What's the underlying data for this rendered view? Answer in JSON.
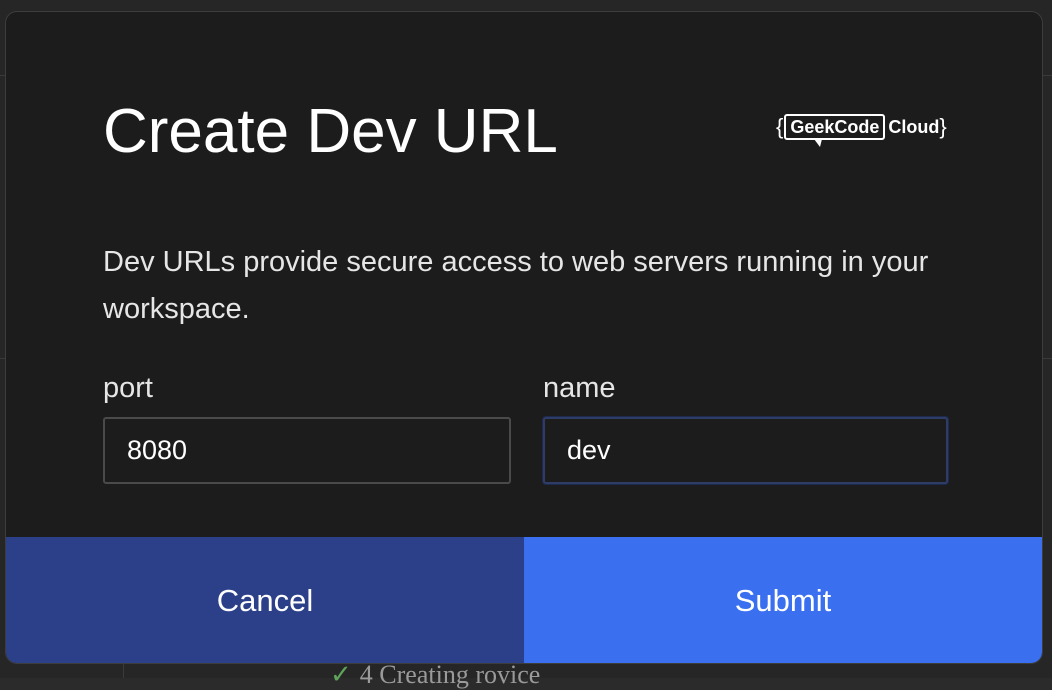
{
  "dialog": {
    "title": "Create Dev URL",
    "description": "Dev URLs provide secure access to web servers running in your workspace.",
    "logo": {
      "open_brace": "{",
      "brand": "GeekCode",
      "suffix": "Cloud",
      "close_brace": "}"
    },
    "port": {
      "label": "port",
      "value": "8080"
    },
    "name": {
      "label": "name",
      "value": "dev"
    },
    "cancel_label": "Cancel",
    "submit_label": "Submit"
  },
  "background": {
    "partial_text": "4 Creating rovice"
  },
  "colors": {
    "dialog_bg": "#1c1c1c",
    "cancel_bg": "#2b4089",
    "submit_bg": "#3a6ff0",
    "text": "#ffffff"
  }
}
